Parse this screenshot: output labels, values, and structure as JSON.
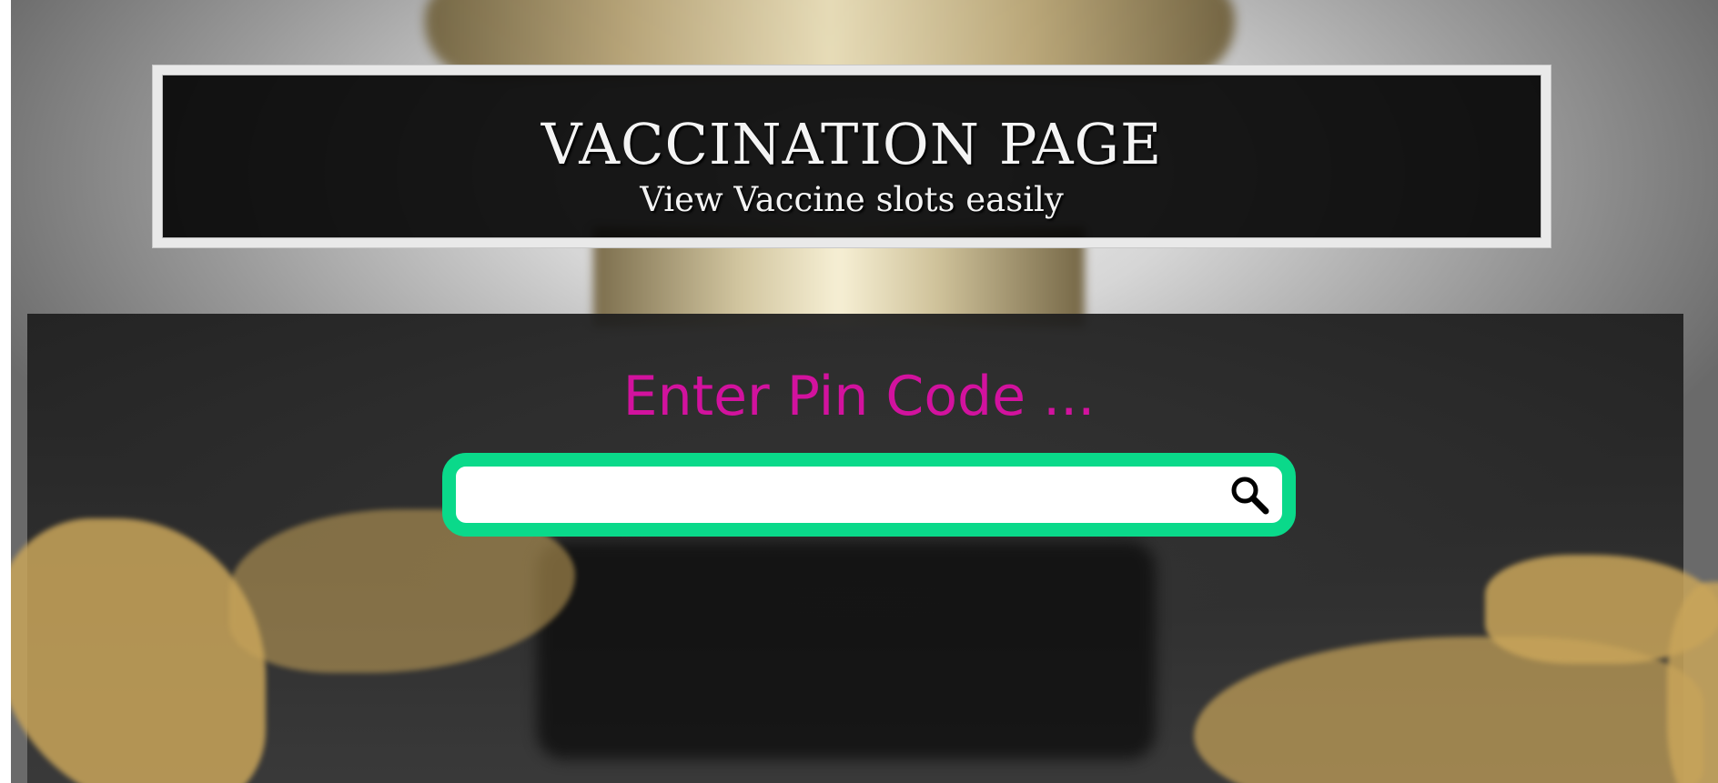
{
  "header": {
    "title": "VACCINATION PAGE",
    "subtitle": "View Vaccine slots easily"
  },
  "search": {
    "label": "Enter Pin Code ...",
    "value": "",
    "placeholder": "",
    "icon": "search-icon"
  },
  "colors": {
    "accent_border": "#0ad98a",
    "label_color": "#d2129e",
    "title_bg": "#0b0b0b",
    "panel_bg": "#222222"
  }
}
